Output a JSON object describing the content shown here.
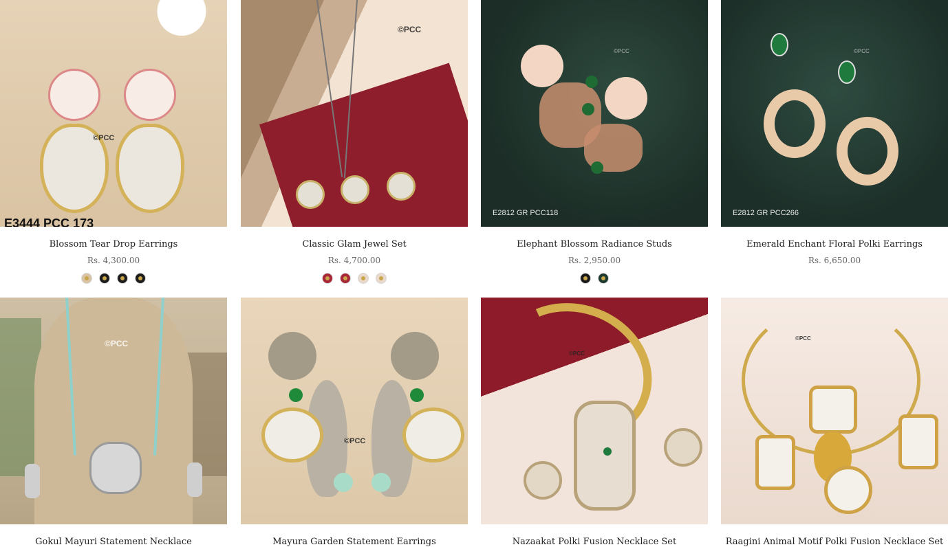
{
  "products": [
    {
      "name": "Blossom Tear Drop Earrings",
      "price": "Rs. 4,300.00",
      "watermark": "©PCC",
      "code": "E3444 PCC 173",
      "swatches": [
        {
          "color": "#d9c3a3"
        },
        {
          "color": "#1c1c1c"
        },
        {
          "color": "#1c1c1c"
        },
        {
          "color": "#1c1c1c"
        }
      ]
    },
    {
      "name": "Classic Glam Jewel Set",
      "price": "Rs. 4,700.00",
      "watermark": "©PCC",
      "swatches": [
        {
          "color": "#a82838"
        },
        {
          "color": "#a82838"
        },
        {
          "color": "#e9d8cc"
        },
        {
          "color": "#e9d8cc"
        }
      ]
    },
    {
      "name": "Elephant Blossom Radiance Studs",
      "price": "Rs. 2,950.00",
      "watermark": "©PCC",
      "code": "E2812 GR PCC118",
      "swatches": [
        {
          "color": "#1a1a1a"
        },
        {
          "color": "#1e3a2e"
        }
      ]
    },
    {
      "name": "Emerald Enchant Floral Polki Earrings",
      "price": "Rs. 6,650.00",
      "watermark": "©PCC",
      "code": "E2812 GR PCC266"
    },
    {
      "name": "Gokul Mayuri Statement Necklace",
      "watermark": "©PCC"
    },
    {
      "name": "Mayura Garden Statement Earrings",
      "watermark": "©PCC"
    },
    {
      "name": "Nazaakat Polki Fusion Necklace Set",
      "watermark": "©PCC"
    },
    {
      "name": "Raagini Animal Motif Polki Fusion Necklace Set",
      "watermark": "©PCC"
    }
  ]
}
